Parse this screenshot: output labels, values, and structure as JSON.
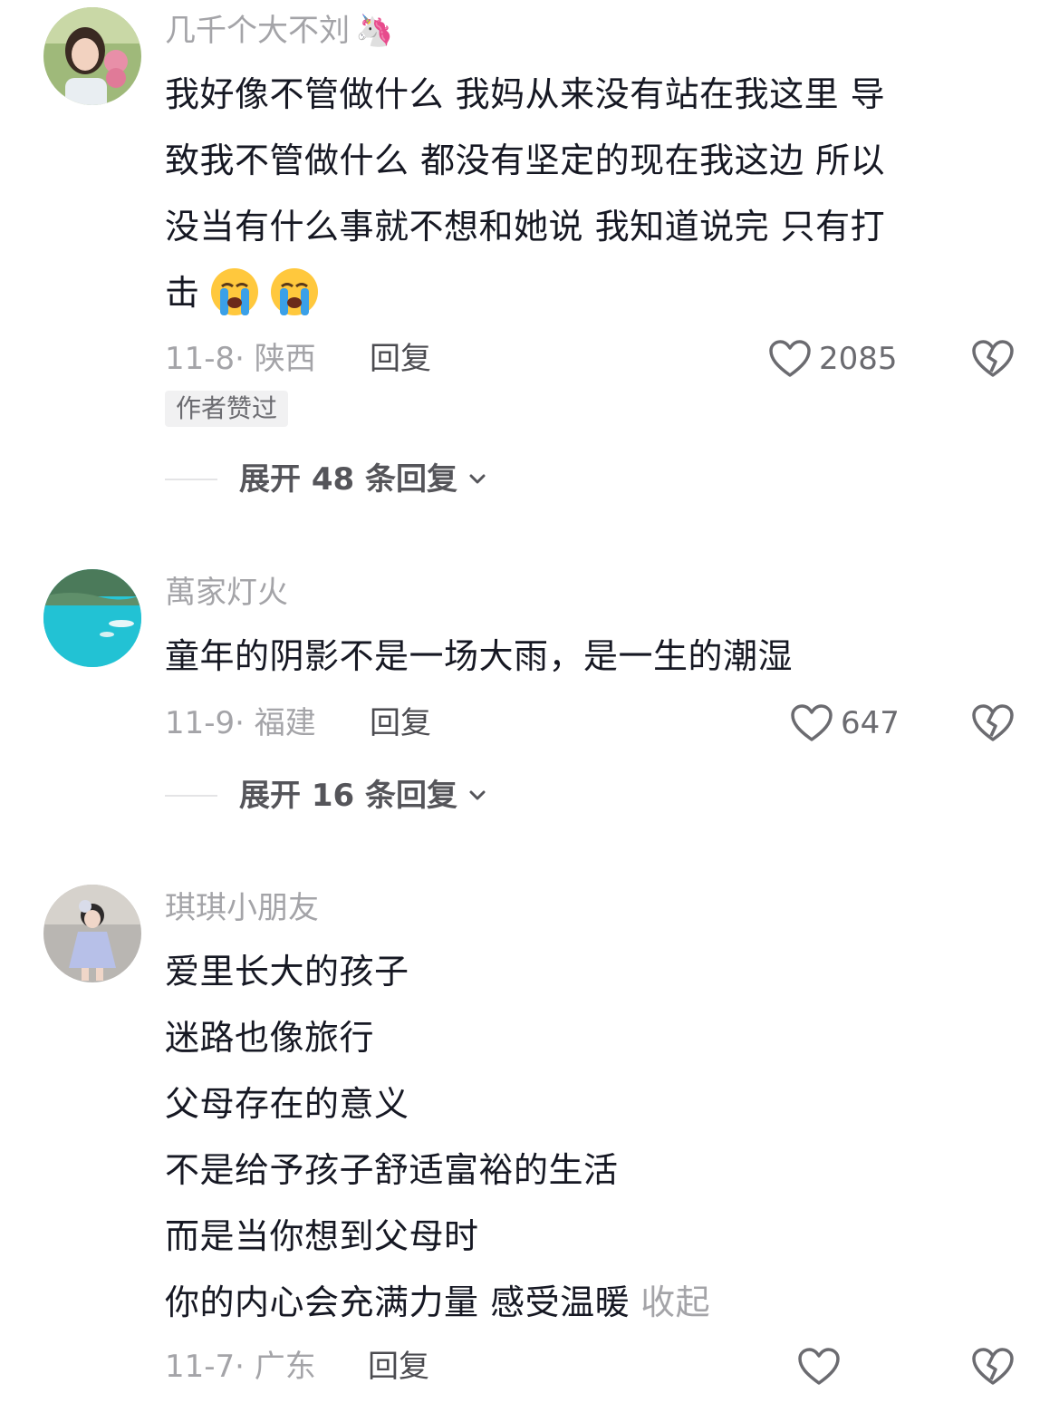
{
  "comments": [
    {
      "username": "几千个大不刘",
      "username_emoji": "🦄",
      "lines": [
        "我好像不管做什么 我妈从来没有站在我这里 导",
        "致我不管做什么 都没有坚定的现在我这边 所以",
        "没当有什么事就不想和她说 我知道说完 只有打",
        "击"
      ],
      "date_location": "11-8· 陕西",
      "reply_label": "回复",
      "like_count": "2085",
      "badge": "作者赞过",
      "expand_label": "展开 48 条回复"
    },
    {
      "username": "萬家灯火",
      "lines": [
        "童年的阴影不是一场大雨，是一生的潮湿"
      ],
      "date_location": "11-9· 福建",
      "reply_label": "回复",
      "like_count": "647",
      "expand_label": "展开 16 条回复"
    },
    {
      "username": "琪琪小朋友",
      "lines": [
        "爱里长大的孩子",
        "迷路也像旅行",
        "父母存在的意义",
        "不是给予孩子舒适富裕的生活",
        "而是当你想到父母时",
        "你的内心会充满力量 感受温暖"
      ],
      "collapse_label": "收起",
      "date_location": "11-7· 广东",
      "reply_label": "回复"
    }
  ],
  "icons": {
    "like": "heart-outline-icon",
    "dislike": "broken-heart-icon",
    "expand": "chevron-down-icon",
    "crying": "loudly-crying-face-icon"
  },
  "colors": {
    "text_primary": "#161823",
    "text_secondary": "#a4a4a8",
    "reply": "#4b4b50",
    "emoji_face": "#ffc83d"
  }
}
